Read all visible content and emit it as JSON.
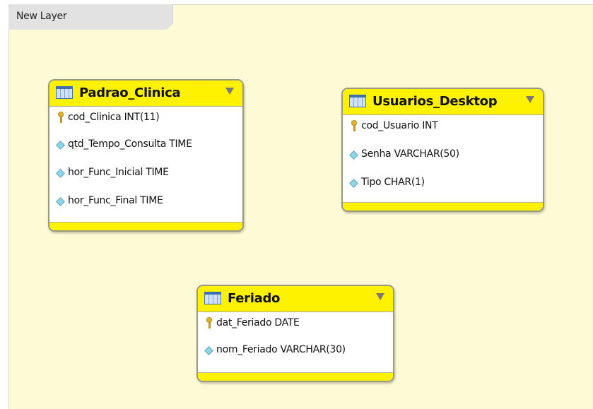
{
  "layer": {
    "label": "New Layer"
  },
  "tables": [
    {
      "name": "Padrao_Clinica",
      "columns": [
        {
          "text": "cod_Clinica INT(11)",
          "icon": "key-icon"
        },
        {
          "text": "qtd_Tempo_Consulta TIME",
          "icon": "column-diamond-icon"
        },
        {
          "text": "hor_Func_Inicial TIME",
          "icon": "column-diamond-icon"
        },
        {
          "text": "hor_Func_Final TIME",
          "icon": "column-diamond-icon"
        }
      ]
    },
    {
      "name": "Usuarios_Desktop",
      "columns": [
        {
          "text": "cod_Usuario INT",
          "icon": "key-icon"
        },
        {
          "text": "Senha VARCHAR(50)",
          "icon": "column-diamond-icon"
        },
        {
          "text": "Tipo CHAR(1)",
          "icon": "column-diamond-icon"
        }
      ]
    },
    {
      "name": "Feriado",
      "columns": [
        {
          "text": "dat_Feriado DATE",
          "icon": "key-icon"
        },
        {
          "text": "nom_Feriado VARCHAR(30)",
          "icon": "column-diamond-icon"
        }
      ]
    }
  ],
  "colors": {
    "header": "#fff200",
    "canvas": "#fdfbd6",
    "tab": "#e2e2e2"
  }
}
